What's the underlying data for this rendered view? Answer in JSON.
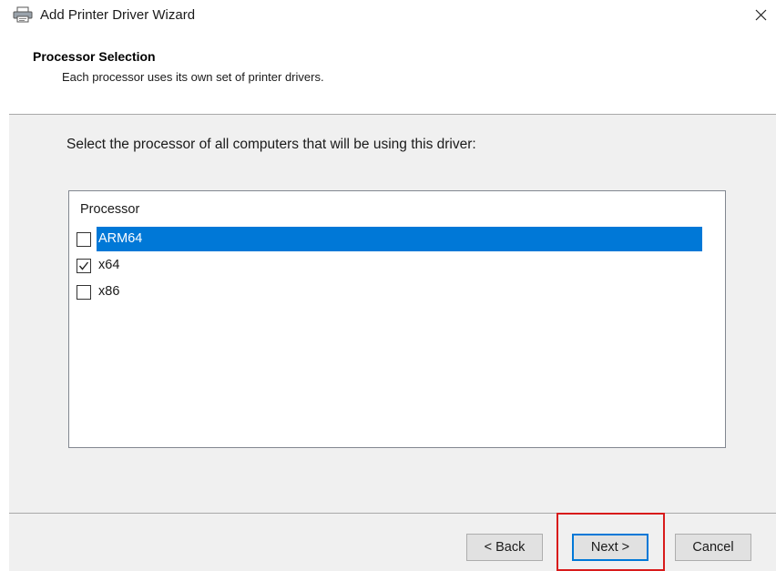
{
  "window": {
    "title": "Add Printer Driver Wizard",
    "title_icon": "printer-icon",
    "close_icon": "close-icon"
  },
  "header": {
    "title": "Processor Selection",
    "subtitle": "Each processor uses its own set of printer drivers."
  },
  "main": {
    "instruction": "Select the processor of all computers that will be using this driver:",
    "list": {
      "header": "Processor",
      "items": [
        {
          "label": "ARM64",
          "checked": false,
          "selected": true
        },
        {
          "label": "x64",
          "checked": true,
          "selected": false
        },
        {
          "label": "x86",
          "checked": false,
          "selected": false
        }
      ]
    }
  },
  "footer": {
    "back_label": "< Back",
    "next_label": "Next >",
    "cancel_label": "Cancel"
  },
  "colors": {
    "selection": "#0078d7",
    "highlight": "#d81b1b"
  }
}
